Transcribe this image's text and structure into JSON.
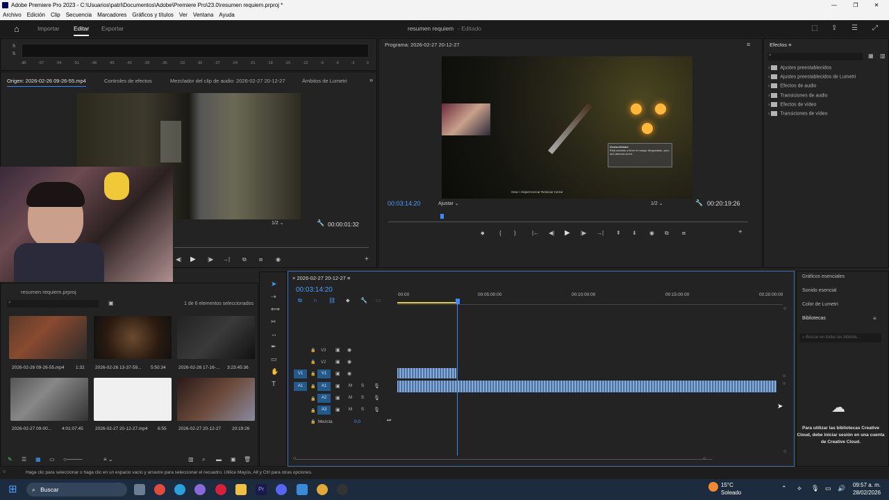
{
  "window_title": "Adobe Premiere Pro 2023 - C:\\Usuarios\\patri\\Documentos\\Adobe\\Premiere Pro\\23.0\\resumen requiem.prproj *",
  "menu": [
    "Archivo",
    "Edición",
    "Clip",
    "Secuencia",
    "Marcadores",
    "Gráficos y títulos",
    "Ver",
    "Ventana",
    "Ayuda"
  ],
  "workspace_tabs": {
    "import": "Importar",
    "edit": "Editar",
    "export": "Exportar"
  },
  "project_title": "resumen requiem",
  "project_status": "- Editado",
  "audio_meter": {
    "s1": "S",
    "s2": "S",
    "scale": [
      "dB",
      "-57",
      "-54",
      "-51",
      "-48",
      "-45",
      "-42",
      "-39",
      "-36",
      "-33",
      "-30",
      "-27",
      "-24",
      "-21",
      "-18",
      "-15",
      "-12",
      "-9",
      "-6",
      "-3",
      "0"
    ]
  },
  "source_tabs": [
    "Origen: 2026-02-26 09-26-55.mp4",
    "Controles de efectos",
    "Mezclador del clip de audio: 2026-02-27 20-12-27",
    "Ámbitos de Lumetri"
  ],
  "source": {
    "resolution": "1/2",
    "duration": "00:00:01:32"
  },
  "program": {
    "title": "Programa: 2026-02-27 20-12-27",
    "timecode": "00:03:14:20",
    "fit": "Ajustar",
    "resolution": "1/2",
    "duration": "00:20:19:26",
    "game_popup_title": "Destornillador",
    "game_popup_text": "Está oxidado y tiene el mango desgastado, pero aún debería servir.",
    "game_hints": "Girar  /  Alejar/Acercar  Reiniciar  Cerrar"
  },
  "effects": {
    "title": "Efectos",
    "items": [
      "Ajustes preestablecidos",
      "Ajustes preestablecidos de Lumetri",
      "Efectos de audio",
      "Transiciones de audio",
      "Efectos de vídeo",
      "Transiciones de vídeo"
    ]
  },
  "right_panels": {
    "graphics": "Gráficos esenciales",
    "sound": "Sonido esencial",
    "lumetri": "Color de Lumetri",
    "libraries": "Bibliotecas",
    "search_placeholder": "Buscar en todas las bibliote...",
    "cc_message": "Para utilizar las bibliotecas Creative Cloud, debe iniciar sesión en una cuenta de Creative Cloud."
  },
  "project": {
    "name": "resumen requiem.prproj",
    "selection": "1 de 6 elementos seleccionados",
    "items": [
      {
        "name": "2026-02-26 09-26-55.mp4",
        "dur": "1:32"
      },
      {
        "name": "2026-02-26 13-37-59...",
        "dur": "5:50:34"
      },
      {
        "name": "2026-02-26 17-16-...",
        "dur": "3:23:45:36"
      },
      {
        "name": "2026-02-27 09-00...",
        "dur": "4:01:07:45"
      },
      {
        "name": "2026-02-27 20-12-27.mp4",
        "dur": "6:55"
      },
      {
        "name": "2026-02-27 20-12-27",
        "dur": "20:19:26"
      }
    ]
  },
  "timeline": {
    "tab": "2026-02-27 20-12-27",
    "timecode": "00:03:14:20",
    "ruler": [
      "00:00",
      "00:05:00:00",
      "00:10:00:00",
      "00:15:00:00",
      "00:20:00:00"
    ],
    "tracks": [
      "V3",
      "V2",
      "V1",
      "A1",
      "A2",
      "A3"
    ],
    "src_v": "V1",
    "src_a": "A1",
    "mix_label": "Mezcla",
    "mix_value": "0.0"
  },
  "status_text": "Haga clic para seleccionar o haga clic en un espacio vacío y arrastre para seleccionar el recuadro. Utilice Mayús, Alt y Ctrl para otras opciones.",
  "taskbar": {
    "search": "Buscar",
    "temp": "15°C",
    "weather": "Soleado",
    "time": "09:57 a. m.",
    "date": "28/02/2026"
  },
  "colors": {
    "accent": "#3a86ff",
    "timecode": "#4a9dff",
    "playhead": "#3d8bff"
  }
}
